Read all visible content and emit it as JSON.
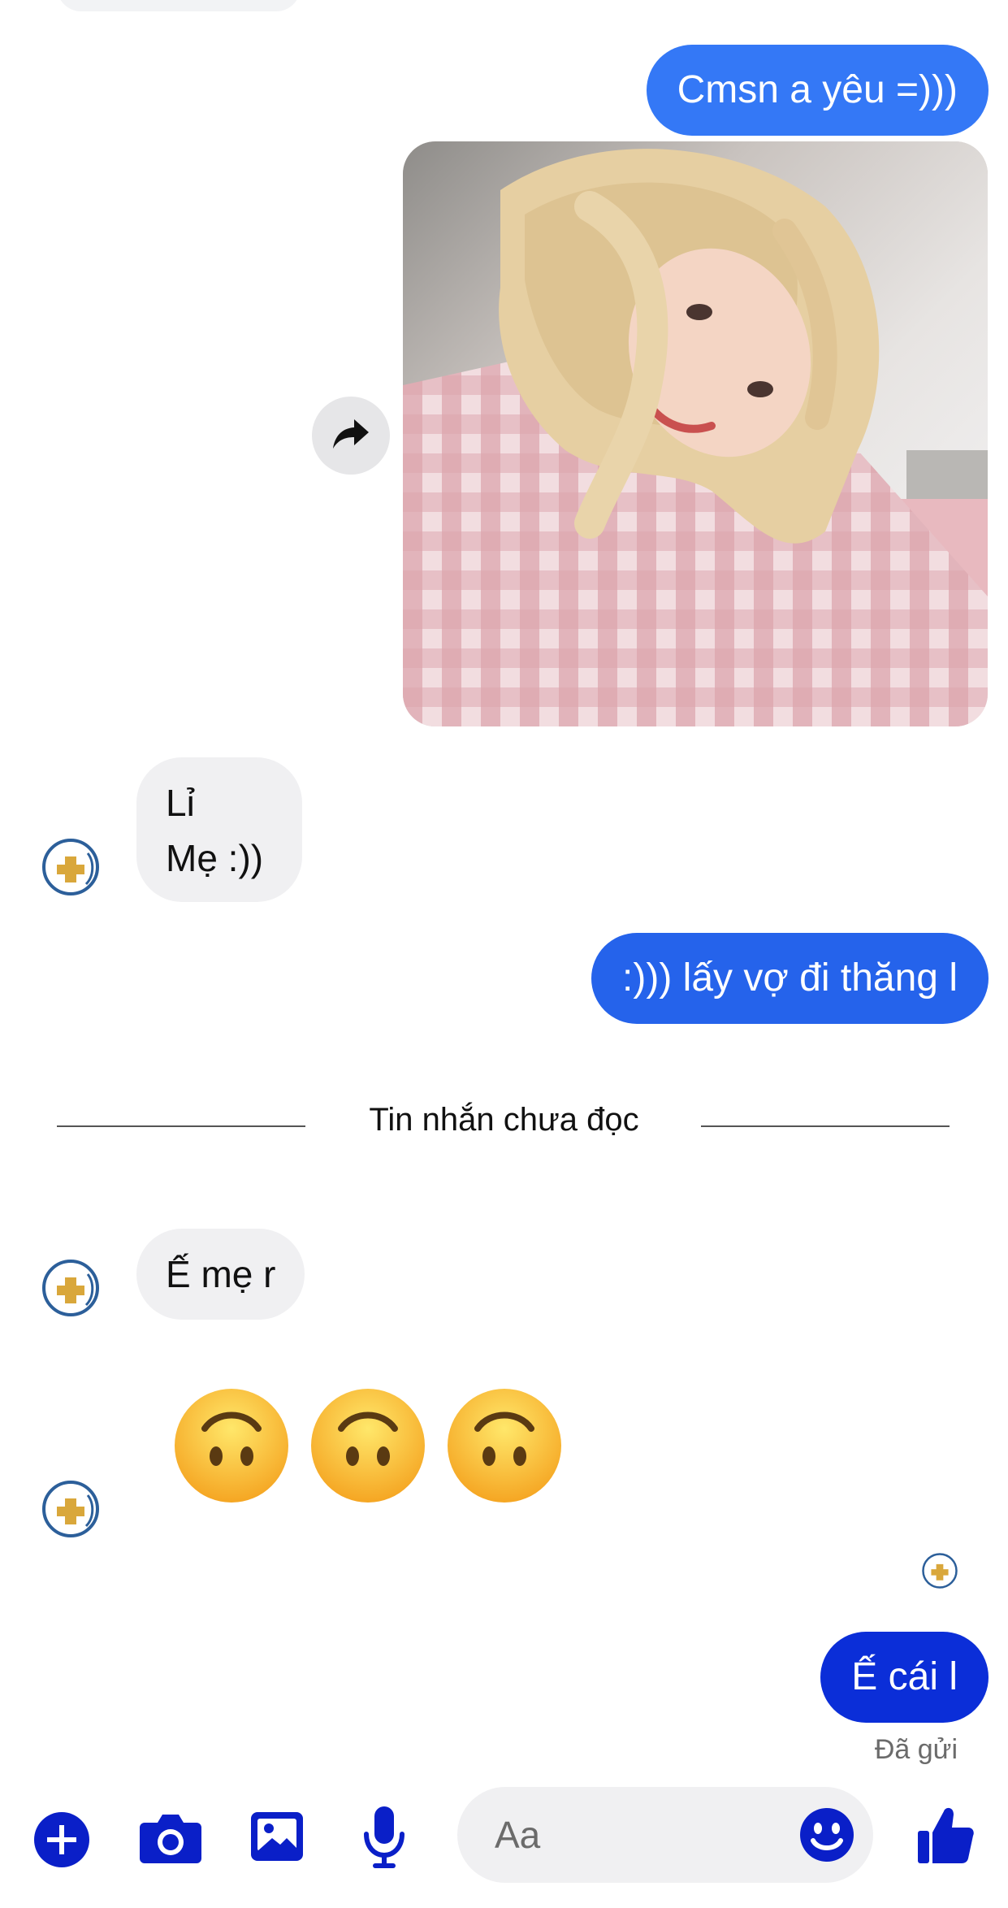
{
  "messages": {
    "out_1": "Cmsn a yêu =)))",
    "in_1_line1": "Lỉ",
    "in_1_line2": "Mẹ :))",
    "out_2": ":))) lấy vợ đi thăng l",
    "divider": "Tin nhắn chưa đọc",
    "in_2": "Ế mẹ r",
    "in_3_emojis": [
      "upside-down-face",
      "upside-down-face",
      "upside-down-face"
    ],
    "out_3": "Ế cái l",
    "status": "Đã gửi"
  },
  "composer": {
    "placeholder": "Aa",
    "icons": [
      "plus-icon",
      "camera-icon",
      "gallery-icon",
      "microphone-icon",
      "emoji-icon",
      "thumbs-up-icon"
    ]
  },
  "colors": {
    "bubble_out_light": "#3478f6",
    "bubble_out_dark": "#0b2ed8",
    "bubble_in": "#f0f0f2",
    "toolbar_icon": "#0a1fc8"
  }
}
